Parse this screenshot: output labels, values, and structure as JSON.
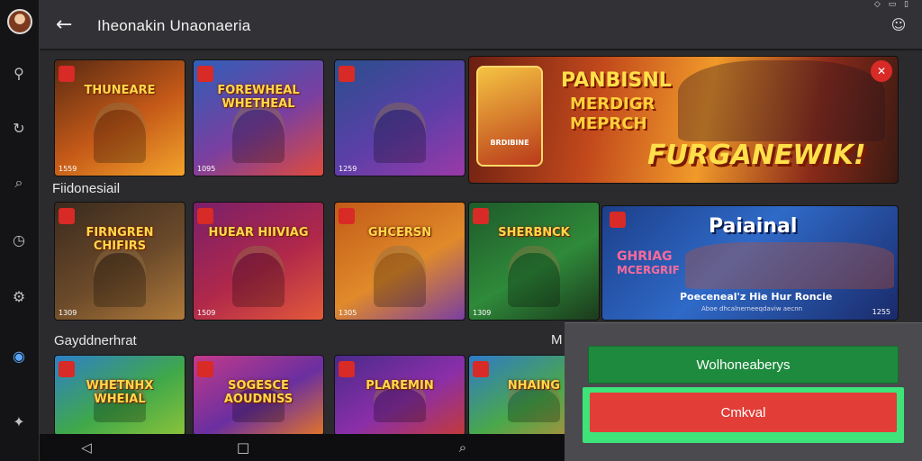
{
  "app": {
    "title": "Ihеonakin Unаonaeria",
    "status_icons": "◇ ▭ ▯"
  },
  "rail": {
    "items": [
      {
        "name": "search-icon",
        "glyph": "⚲"
      },
      {
        "name": "refresh-icon",
        "glyph": "↻"
      },
      {
        "name": "search-alt-icon",
        "glyph": "⌕"
      },
      {
        "name": "clock-icon",
        "glyph": "◷"
      },
      {
        "name": "settings-icon",
        "glyph": "⚙"
      },
      {
        "name": "globe-icon",
        "glyph": "◉"
      },
      {
        "name": "pin-icon",
        "glyph": "✦"
      }
    ]
  },
  "sections": {
    "row2_label": "Fiidonesiail",
    "row3_label": "Gayddnerhrat",
    "row3_more": "M"
  },
  "row1": [
    {
      "text": "THUNEARE",
      "count": "1559",
      "colors": [
        "#5a2a12",
        "#c55a18",
        "#f3a32c"
      ]
    },
    {
      "text": "FOREWHEAL WHETHEAL",
      "count": "1095",
      "colors": [
        "#2f5fb8",
        "#7a3fa0",
        "#e04b3b"
      ]
    },
    {
      "text": "",
      "count": "1259",
      "colors": [
        "#2a4f8c",
        "#5b3fa8",
        "#9a3aa8"
      ]
    }
  ],
  "banner_top": {
    "line1": "PANBISNL",
    "line2": "MERDIGR",
    "line3": "MEPRCH",
    "line4": "FURGANEWIK!",
    "card_text": "BRDIBINE"
  },
  "row2": [
    {
      "text": "FIRNGREN CHIFIRS",
      "count": "1309",
      "colors": [
        "#3a2a1e",
        "#6b4a2a",
        "#b07a3a"
      ]
    },
    {
      "text": "HUEAR HIIVIAG",
      "count": "1509",
      "colors": [
        "#7a1f6a",
        "#b0284a",
        "#e35a3a"
      ]
    },
    {
      "text": "GHCERSN",
      "count": "1305",
      "colors": [
        "#c25a18",
        "#e08a2a",
        "#7a3fa0"
      ]
    },
    {
      "text": "SHERBNCK",
      "count": "1309",
      "colors": [
        "#1e5a2a",
        "#2f8a3a",
        "#1b3a1c"
      ]
    }
  ],
  "banner_mid": {
    "title": "Paiainal",
    "sub1": "GHRIAG",
    "sub2": "MCERGRIF",
    "line": "Poeceneal'z Hie Hur Roncie",
    "small": "Aboe dhcalnerneeqdaviw aecnn",
    "count": "1255"
  },
  "row3": [
    {
      "text": "WHETNHX WHEIAL",
      "colors": [
        "#2e7fc8",
        "#3fa84a",
        "#8ac23a"
      ]
    },
    {
      "text": "SOGESCE AOUDNISS",
      "colors": [
        "#c23a8a",
        "#6a2fa0",
        "#e0742a"
      ]
    },
    {
      "text": "PLAREMIN",
      "colors": [
        "#4a2a8a",
        "#8a2fa8",
        "#c23a3a"
      ]
    },
    {
      "text": "NHAING",
      "colors": [
        "#2f7ac8",
        "#4aa84a",
        "#c28a3a"
      ]
    }
  ],
  "panel": {
    "primary_label": "Wolhoneaberys",
    "secondary_label": "Cmkval"
  },
  "navbar": {
    "back": "◁",
    "home": "□",
    "search": "⌕"
  }
}
